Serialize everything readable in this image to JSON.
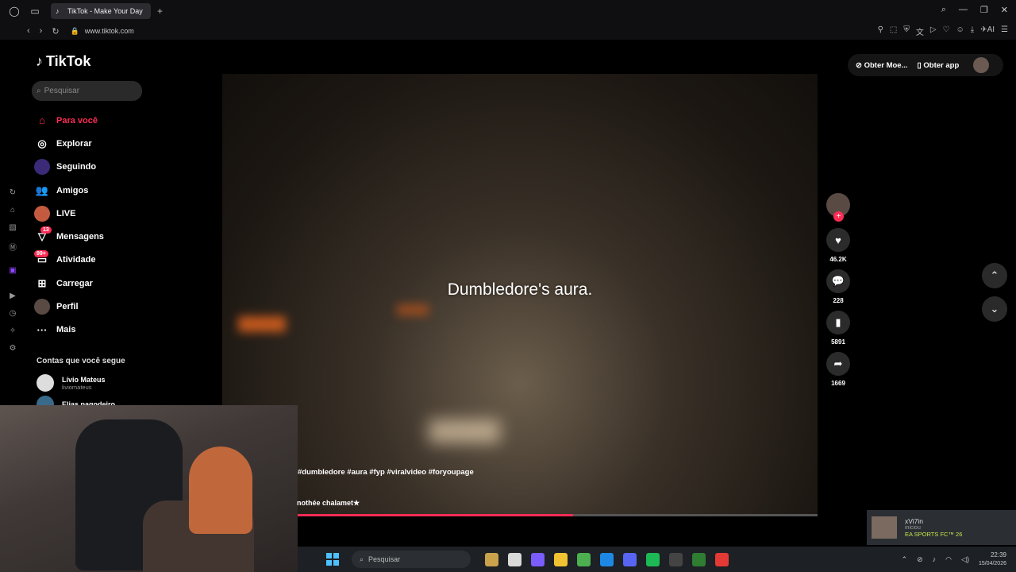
{
  "browser": {
    "tab_title": "TikTok - Make Your Day",
    "new_tab": "+",
    "url": "www.tiktok.com",
    "ai_label": "AI"
  },
  "tiktok": {
    "logo": "TikTok",
    "search_placeholder": "Pesquisar",
    "menu": [
      {
        "label": "Para você",
        "icon": "home-icon",
        "glyph": "⌂",
        "active": true
      },
      {
        "label": "Explorar",
        "icon": "compass-icon",
        "glyph": "◎"
      },
      {
        "label": "Seguindo",
        "icon": "following-avatar",
        "glyph": ""
      },
      {
        "label": "Amigos",
        "icon": "friends-icon",
        "glyph": "👥"
      },
      {
        "label": "LIVE",
        "icon": "live-avatar",
        "glyph": ""
      },
      {
        "label": "Mensagens",
        "icon": "messages-icon",
        "glyph": "▽",
        "badge": "13"
      },
      {
        "label": "Atividade",
        "icon": "activity-icon",
        "glyph": "▭",
        "badge": "99+"
      },
      {
        "label": "Carregar",
        "icon": "upload-icon",
        "glyph": "⊞"
      },
      {
        "label": "Perfil",
        "icon": "profile-avatar",
        "glyph": ""
      },
      {
        "label": "Mais",
        "icon": "more-icon",
        "glyph": "···"
      }
    ],
    "following_title": "Contas que você segue",
    "accounts": [
      {
        "name": "Lívio Mateus",
        "handle": "liviomateus"
      },
      {
        "name": "Elias pagodeiro",
        "handle": ""
      }
    ],
    "top_right": {
      "coins": "Obter Moe...",
      "app": "Obter app"
    }
  },
  "video": {
    "caption": "Dumbledore's aura.",
    "hashtags": "#dumbledore #aura #fyp #viralvideo #foryoupage",
    "music": "nothée chalamet★",
    "progress": 0.53,
    "actions": [
      {
        "name": "like",
        "icon": "heart-icon",
        "glyph": "♥",
        "count": "46.2K"
      },
      {
        "name": "comment",
        "icon": "comment-icon",
        "glyph": "💬",
        "count": "228"
      },
      {
        "name": "save",
        "icon": "bookmark-icon",
        "glyph": "▮",
        "count": "5891"
      },
      {
        "name": "share",
        "icon": "share-icon",
        "glyph": "➦",
        "count": "1669"
      }
    ],
    "follow_plus": "+"
  },
  "notification": {
    "user": "xVi7in",
    "status": "iniciou",
    "game": "EA SPORTS FC™ 26"
  },
  "taskbar": {
    "search_placeholder": "Pesquisar",
    "time": "22:39",
    "date": "15/04/2026",
    "app_colors": [
      "#c9a24b",
      "#d9d9d9",
      "#7a5cff",
      "#f1c232",
      "#4caf50",
      "#1e88e5",
      "#5865f2",
      "#1db954",
      "#444444",
      "#2e7d32",
      "#e53935"
    ]
  },
  "colors": {
    "accent": "#fe2c55",
    "background": "#000000"
  }
}
